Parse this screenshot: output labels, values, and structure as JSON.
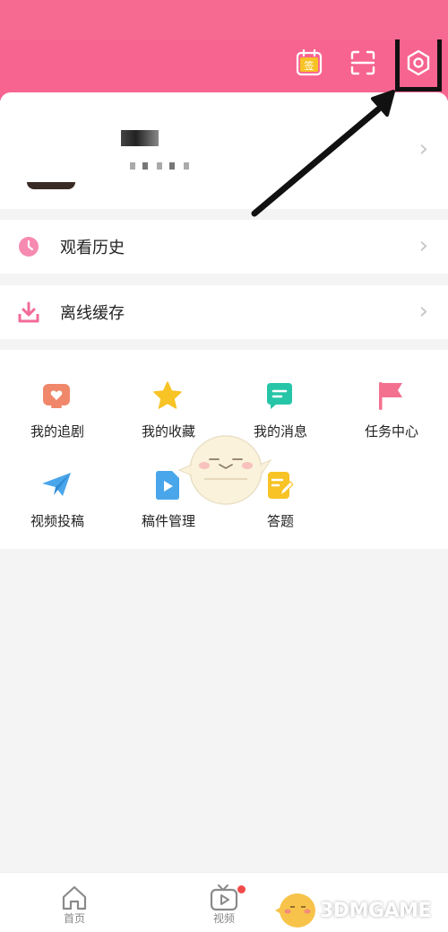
{
  "header": {
    "checkin_badge": "签",
    "icons": [
      "checkin-icon",
      "scan-icon",
      "settings-icon"
    ],
    "accent": "#f7648f"
  },
  "menu": {
    "history_label": "观看历史",
    "offline_label": "离线缓存"
  },
  "grid": {
    "items": [
      {
        "label": "我的追剧",
        "icon": "tv-heart-icon",
        "color": "#f0876b"
      },
      {
        "label": "我的收藏",
        "icon": "star-icon",
        "color": "#f7c325"
      },
      {
        "label": "我的消息",
        "icon": "message-icon",
        "color": "#27c5a8"
      },
      {
        "label": "任务中心",
        "icon": "flag-icon",
        "color": "#f3708e"
      },
      {
        "label": "视频投稿",
        "icon": "paper-plane-icon",
        "color": "#4aa6ea"
      },
      {
        "label": "稿件管理",
        "icon": "video-file-icon",
        "color": "#4aa6ea"
      },
      {
        "label": "答题",
        "icon": "quiz-icon",
        "color": "#f7c325"
      }
    ]
  },
  "bottom_nav": {
    "items": [
      {
        "label": "首页",
        "icon": "home-icon"
      },
      {
        "label": "视频",
        "icon": "video-icon"
      }
    ]
  },
  "watermark": {
    "text": "3DMGAME"
  }
}
